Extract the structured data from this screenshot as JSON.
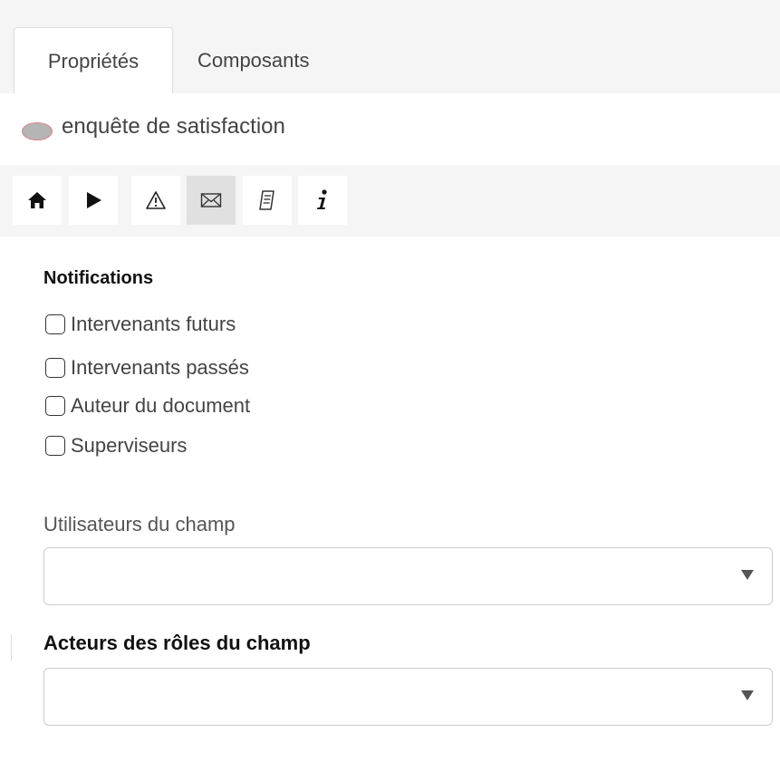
{
  "tabs": [
    {
      "label": "Propriétés",
      "active": true
    },
    {
      "label": "Composants",
      "active": false
    }
  ],
  "header": {
    "title": "enquête de satisfaction",
    "status_dot_color": "#b5b5b5"
  },
  "toolbar": {
    "buttons": [
      {
        "icon": "home-icon",
        "selected": false
      },
      {
        "icon": "play-icon",
        "selected": false
      },
      {
        "icon": "warning-icon",
        "selected": false
      },
      {
        "icon": "envelope-icon",
        "selected": true
      },
      {
        "icon": "script-icon",
        "selected": false
      },
      {
        "icon": "info-icon",
        "selected": false
      }
    ]
  },
  "notifications": {
    "title": "Notifications",
    "options": [
      {
        "label": "Intervenants futurs",
        "checked": false
      },
      {
        "label": "Intervenants passés",
        "checked": false
      },
      {
        "label": "Auteur du document",
        "checked": false
      },
      {
        "label": "Superviseurs",
        "checked": false
      }
    ]
  },
  "fields": {
    "field_users": {
      "label": "Utilisateurs du champ",
      "value": ""
    },
    "role_actors": {
      "label": "Acteurs des rôles du champ",
      "value": ""
    }
  }
}
